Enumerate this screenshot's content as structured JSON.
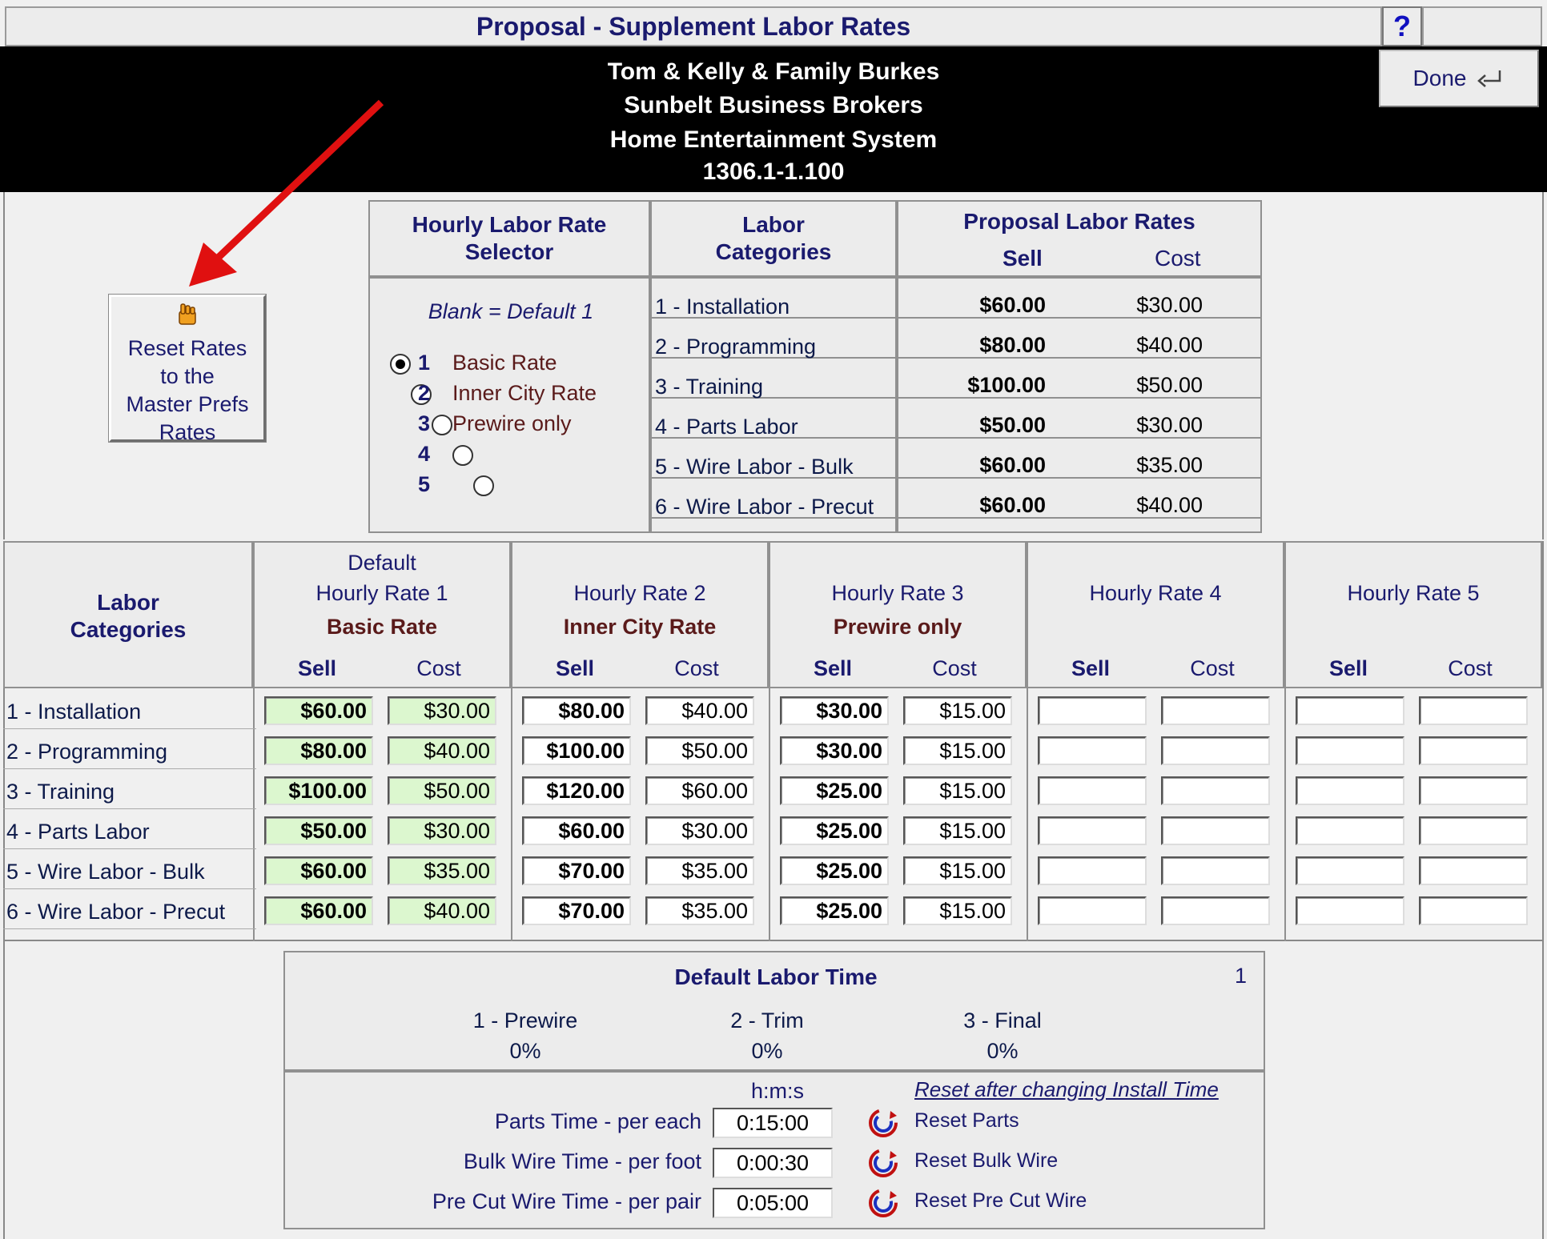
{
  "window": {
    "title": "Proposal - Supplement Labor Rates",
    "help_label": "?",
    "done_label": "Done"
  },
  "header": {
    "client": "Tom & Kelly & Family Burkes",
    "company": "Sunbelt Business Brokers",
    "project": "Home Entertainment System",
    "number": "1306.1-1.100"
  },
  "reset_rates_button": {
    "line1": "Reset Rates",
    "line2": "to the",
    "line3": "Master Prefs",
    "line4": "Rates"
  },
  "selector": {
    "header_line1": "Hourly Labor Rate",
    "header_line2": "Selector",
    "blank_note": "Blank = Default 1",
    "options": [
      {
        "num": "1",
        "label": "Basic Rate",
        "selected": true
      },
      {
        "num": "2",
        "label": "Inner City Rate",
        "selected": false
      },
      {
        "num": "3",
        "label": "Prewire only",
        "selected": false
      },
      {
        "num": "4",
        "label": "",
        "selected": false
      },
      {
        "num": "5",
        "label": "",
        "selected": false
      }
    ]
  },
  "labor_categories_header": {
    "line1": "Labor",
    "line2": "Categories"
  },
  "proposal_rates": {
    "header": "Proposal Labor Rates",
    "sell_label": "Sell",
    "cost_label": "Cost",
    "rows": [
      {
        "category": "1 - Installation",
        "sell": "$60.00",
        "cost": "$30.00"
      },
      {
        "category": "2 - Programming",
        "sell": "$80.00",
        "cost": "$40.00"
      },
      {
        "category": "3 - Training",
        "sell": "$100.00",
        "cost": "$50.00"
      },
      {
        "category": "4 - Parts Labor",
        "sell": "$50.00",
        "cost": "$30.00"
      },
      {
        "category": "5 - Wire Labor - Bulk",
        "sell": "$60.00",
        "cost": "$35.00"
      },
      {
        "category": "6 - Wire Labor - Precut",
        "sell": "$60.00",
        "cost": "$40.00"
      }
    ]
  },
  "rate_grid": {
    "categories_header_line1": "Labor",
    "categories_header_line2": "Categories",
    "columns": [
      {
        "top": "Default",
        "title": "Hourly Rate 1",
        "name": "Basic Rate",
        "sell_label": "Sell",
        "cost_label": "Cost"
      },
      {
        "top": "",
        "title": "Hourly Rate 2",
        "name": "Inner City Rate",
        "sell_label": "Sell",
        "cost_label": "Cost"
      },
      {
        "top": "",
        "title": "Hourly Rate 3",
        "name": "Prewire only",
        "sell_label": "Sell",
        "cost_label": "Cost"
      },
      {
        "top": "",
        "title": "Hourly Rate 4",
        "name": "",
        "sell_label": "Sell",
        "cost_label": "Cost"
      },
      {
        "top": "",
        "title": "Hourly Rate 5",
        "name": "",
        "sell_label": "Sell",
        "cost_label": "Cost"
      }
    ],
    "rows": [
      {
        "category": "1 - Installation",
        "values": [
          [
            "$60.00",
            "$30.00"
          ],
          [
            "$80.00",
            "$40.00"
          ],
          [
            "$30.00",
            "$15.00"
          ],
          [
            "",
            ""
          ],
          [
            "",
            ""
          ]
        ]
      },
      {
        "category": "2 - Programming",
        "values": [
          [
            "$80.00",
            "$40.00"
          ],
          [
            "$100.00",
            "$50.00"
          ],
          [
            "$30.00",
            "$15.00"
          ],
          [
            "",
            ""
          ],
          [
            "",
            ""
          ]
        ]
      },
      {
        "category": "3 - Training",
        "values": [
          [
            "$100.00",
            "$50.00"
          ],
          [
            "$120.00",
            "$60.00"
          ],
          [
            "$25.00",
            "$15.00"
          ],
          [
            "",
            ""
          ],
          [
            "",
            ""
          ]
        ]
      },
      {
        "category": "4 - Parts Labor",
        "values": [
          [
            "$50.00",
            "$30.00"
          ],
          [
            "$60.00",
            "$30.00"
          ],
          [
            "$25.00",
            "$15.00"
          ],
          [
            "",
            ""
          ],
          [
            "",
            ""
          ]
        ]
      },
      {
        "category": "5 - Wire Labor - Bulk",
        "values": [
          [
            "$60.00",
            "$35.00"
          ],
          [
            "$70.00",
            "$35.00"
          ],
          [
            "$25.00",
            "$15.00"
          ],
          [
            "",
            ""
          ],
          [
            "",
            ""
          ]
        ]
      },
      {
        "category": "6 - Wire Labor - Precut",
        "values": [
          [
            "$60.00",
            "$40.00"
          ],
          [
            "$70.00",
            "$35.00"
          ],
          [
            "$25.00",
            "$15.00"
          ],
          [
            "",
            ""
          ],
          [
            "",
            ""
          ]
        ]
      }
    ]
  },
  "default_labor_time": {
    "header": "Default Labor Time",
    "count": "1",
    "phases": [
      {
        "label": "1 - Prewire",
        "value": "0%"
      },
      {
        "label": "2 - Trim",
        "value": "0%"
      },
      {
        "label": "3 - Final",
        "value": "0%"
      }
    ],
    "hms_label": "h:m:s",
    "reset_note": "Reset after changing Install Time",
    "times": [
      {
        "label": "Parts Time - per each",
        "value": "0:15:00",
        "reset": "Reset Parts"
      },
      {
        "label": "Bulk Wire Time - per foot",
        "value": "0:00:30",
        "reset": "Reset Bulk Wire"
      },
      {
        "label": "Pre Cut Wire Time - per pair",
        "value": "0:05:00",
        "reset": "Reset Pre Cut Wire"
      }
    ]
  },
  "colors": {
    "accent_text": "#1a1a6e",
    "default_rate_field": "#dcf7cf",
    "rate_name": "#5a1a1a",
    "arrow": "#e01010"
  }
}
